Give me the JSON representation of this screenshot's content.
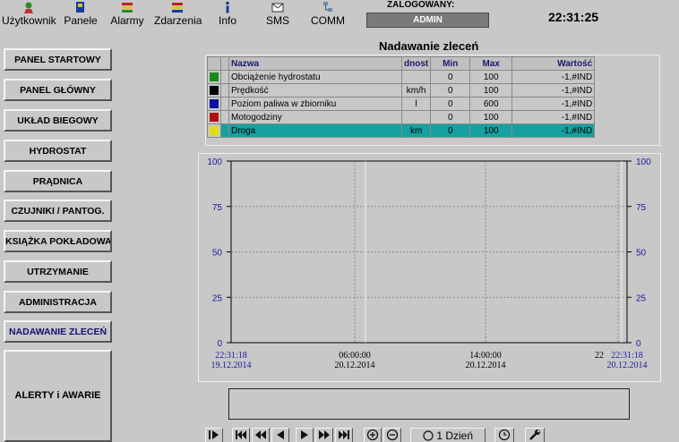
{
  "toolbar": {
    "items": [
      {
        "label": "Użytkownik",
        "icon": "user-icon"
      },
      {
        "label": "Panele",
        "icon": "panels-icon"
      },
      {
        "label": "Alarmy",
        "icon": "alarm-icon"
      },
      {
        "label": "Zdarzenia",
        "icon": "events-icon"
      },
      {
        "label": "Info",
        "icon": "info-icon"
      },
      {
        "label": "SMS",
        "icon": "envelope-icon"
      },
      {
        "label": "COMM",
        "icon": "network-icon"
      }
    ],
    "logged_label": "ZALOGOWANY:",
    "user": "ADMIN",
    "clock": "22:31:25"
  },
  "sidebar": {
    "items": [
      {
        "label": "PANEL STARTOWY"
      },
      {
        "label": "PANEL GŁÓWNY"
      },
      {
        "label": "UKŁAD BIEGOWY"
      },
      {
        "label": "HYDROSTAT"
      },
      {
        "label": "PRĄDNICA"
      },
      {
        "label": "CZUJNIKI / PANTOG."
      },
      {
        "label": "KSIĄŻKA POKŁADOWA"
      },
      {
        "label": "UTRZYMANIE"
      },
      {
        "label": "ADMINISTRACJA"
      },
      {
        "label": "NADAWANIE ZLECEŃ"
      }
    ],
    "alert_button": "ALERTY i AWARIE"
  },
  "page_title": "Nadawanie zleceń",
  "table": {
    "headers": {
      "name": "Nazwa",
      "unit": "dnost",
      "min": "Min",
      "max": "Max",
      "value": "Wartość"
    },
    "rows": [
      {
        "color": "#1a8a1a",
        "name": "Obciążenie hydrostatu",
        "unit": "",
        "min": "0",
        "max": "100",
        "value": "-1,#IND"
      },
      {
        "color": "#000000",
        "name": "Prędkość",
        "unit": "km/h",
        "min": "0",
        "max": "100",
        "value": "-1,#IND"
      },
      {
        "color": "#1010a0",
        "name": "Poziom paliwa w zbiorniku",
        "unit": "l",
        "min": "0",
        "max": "600",
        "value": "-1,#IND"
      },
      {
        "color": "#b01010",
        "name": "Motogodziny",
        "unit": "",
        "min": "0",
        "max": "100",
        "value": "-1,#IND"
      },
      {
        "color": "#e0e000",
        "name": "Droga",
        "unit": "km",
        "min": "0",
        "max": "100",
        "value": "-1,#IND"
      }
    ]
  },
  "chart_data": {
    "type": "line",
    "y_ticks": [
      "0",
      "25",
      "50",
      "75",
      "100"
    ],
    "ylim": [
      0,
      100
    ],
    "x_ticks": [
      {
        "time": "22:31:18",
        "date": "19.12.2014"
      },
      {
        "time": "06:00:00",
        "date": "20.12.2014"
      },
      {
        "time": "14:00:00",
        "date": "20.12.2014"
      },
      {
        "time": "22:31:18",
        "date": "20.12.2014"
      }
    ],
    "x_partial": "22",
    "series": []
  },
  "controls": {
    "period_label": "1 Dzień"
  }
}
